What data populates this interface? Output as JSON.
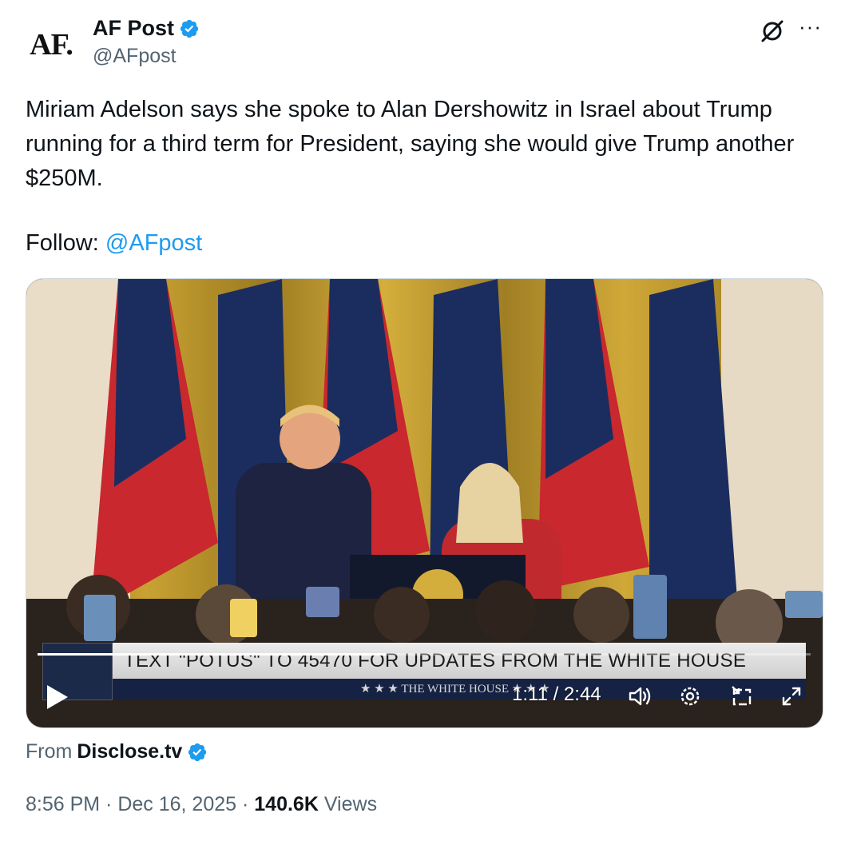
{
  "author": {
    "avatar_text": "AF.",
    "display_name": "AF Post",
    "handle": "@AFpost",
    "verified": true
  },
  "header_icons": [
    "grok-icon",
    "more-icon"
  ],
  "tweet": {
    "text": "Miriam Adelson says she spoke to Alan Dershowitz in Israel about Trump running for a third term for President, saying she would give Trump another $250M.",
    "follow_label": "Follow: ",
    "follow_link": "@AFpost"
  },
  "video": {
    "banner_text": "TEXT \"POTUS\" TO 45470 FOR UPDATES FROM THE WHITE HOUSE",
    "banner_sub": "★ ★ ★  THE WHITE HOUSE  ★ ★ ★",
    "time": "1:11 / 2:44",
    "progress_fraction": 0.45,
    "controls": [
      "play-icon",
      "volume-icon",
      "settings-icon",
      "pip-icon",
      "fullscreen-icon"
    ]
  },
  "source": {
    "prefix": "From ",
    "name": "Disclose.tv",
    "verified": true
  },
  "meta": {
    "time": "8:56 PM",
    "date": "Dec 16, 2025",
    "views_count": "140.6K",
    "views_label": " Views",
    "separator": " · "
  },
  "colors": {
    "link": "#1d9bf0",
    "secondary_text": "#536471",
    "verified_badge": "#1d9bf0"
  }
}
